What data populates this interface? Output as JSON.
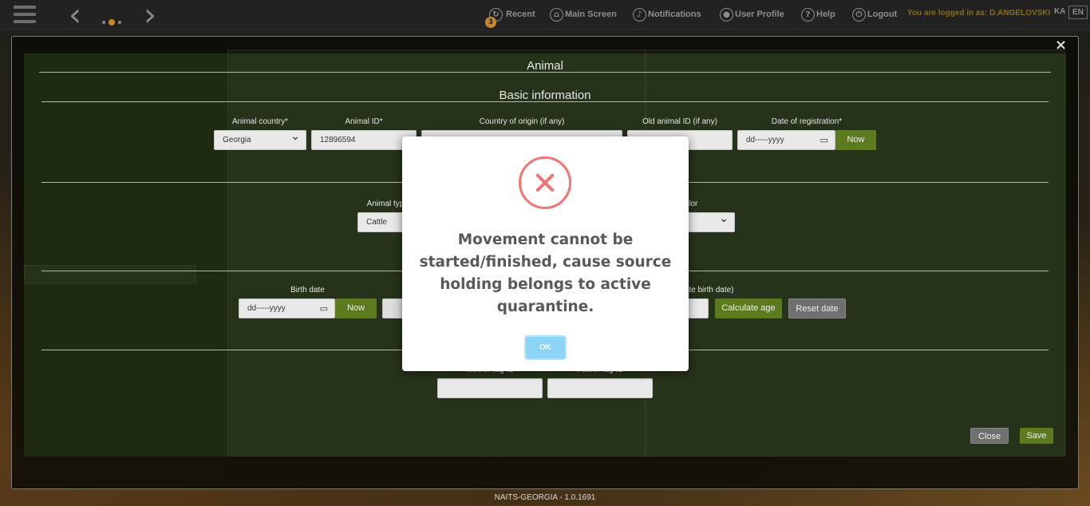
{
  "topbar": {
    "recent_label": "Recent",
    "recent_count": "3",
    "main_screen_label": "Main Screen",
    "notifications_label": "Notifications",
    "user_profile_label": "User Profile",
    "help_label": "Help",
    "logout_label": "Logout",
    "logged_in_text": "You are logged in as: D.ANGELOVSKI",
    "lang_ka": "KA",
    "lang_en": "EN"
  },
  "form": {
    "title": "Animal",
    "section_basic": "Basic information",
    "animal_country_label": "Animal country*",
    "animal_country_value": "Georgia",
    "animal_id_label": "Animal ID*",
    "animal_id_value": "12896594",
    "country_origin_label": "Country of origin (if any)",
    "old_animal_id_label": "Old animal ID (if any)",
    "date_registration_label": "Date of registration*",
    "date_placeholder": "dd-----yyyy",
    "now_label": "Now",
    "animal_type_label": "Animal typ",
    "animal_type_value": "Cattle",
    "color_label": "olor",
    "birth_date_label": "Birth date",
    "calc_birth_label": "ulate birth date)",
    "calculate_age_label": "Calculate age",
    "reset_date_label": "Reset date",
    "mother_tag_label": "Mother tag ID",
    "father_tag_label": "Father tag ID",
    "close_label": "Close",
    "save_label": "Save"
  },
  "alert": {
    "message": "Movement cannot be started/finished, cause source holding belongs to active quarantine.",
    "ok_label": "OK"
  },
  "footer": {
    "version": "NAITS-GEORGIA - 1.0.1691"
  },
  "colors": {
    "accent_green": "#5c7a1e",
    "error_red": "#f27474",
    "ok_blue": "#8cd4f5",
    "logged_in_gold": "#8a6a1a"
  }
}
